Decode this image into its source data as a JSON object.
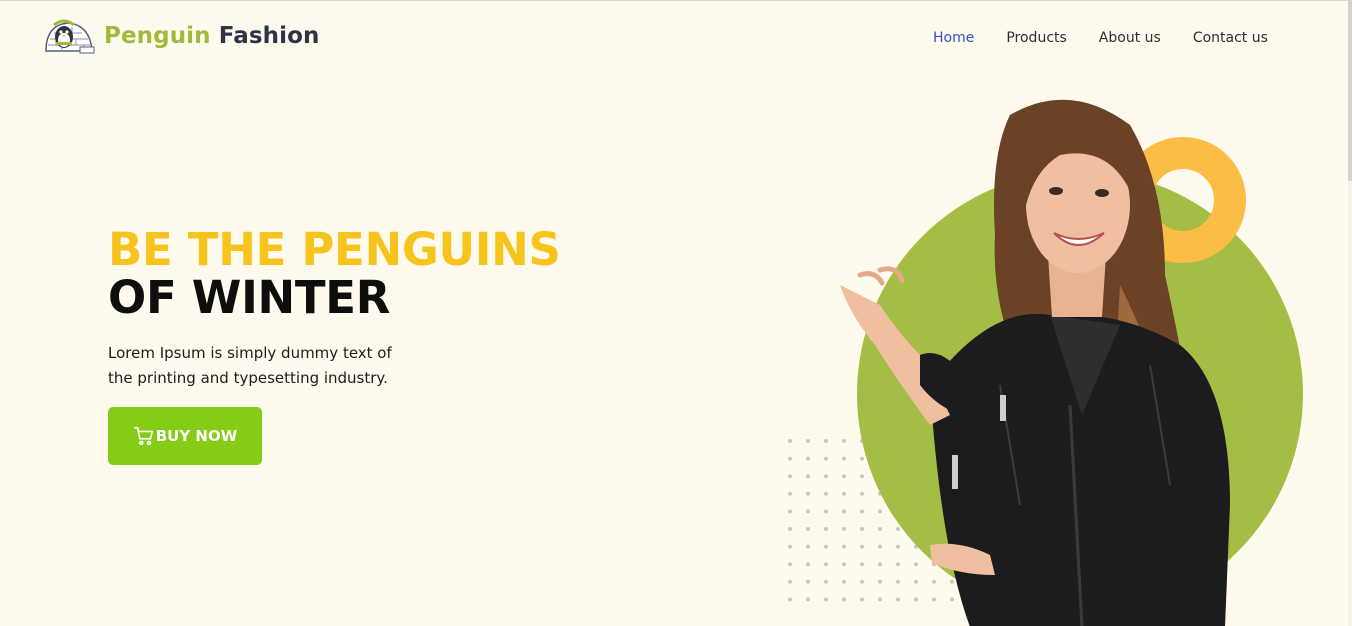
{
  "brand": {
    "name_part1": "Penguin",
    "name_part2": "Fashion",
    "logo_icon": "penguin-igloo-icon"
  },
  "nav": {
    "items": [
      {
        "label": "Home",
        "active": true
      },
      {
        "label": "Products",
        "active": false
      },
      {
        "label": "About us",
        "active": false
      },
      {
        "label": "Contact us",
        "active": false
      }
    ]
  },
  "hero": {
    "headline_line1": "BE THE PENGUINS",
    "headline_line2": "OF WINTER",
    "description": "Lorem Ipsum is simply dummy text of the printing and typesetting industry.",
    "cta_label": "BUY NOW",
    "cta_icon": "cart-icon"
  },
  "colors": {
    "background": "#fffaee",
    "accent_yellow": "#f6c41d",
    "accent_green": "#84cc16",
    "circle_green": "#a3bd45",
    "ring_orange": "#fbbd45",
    "nav_active": "#2f50c8"
  }
}
